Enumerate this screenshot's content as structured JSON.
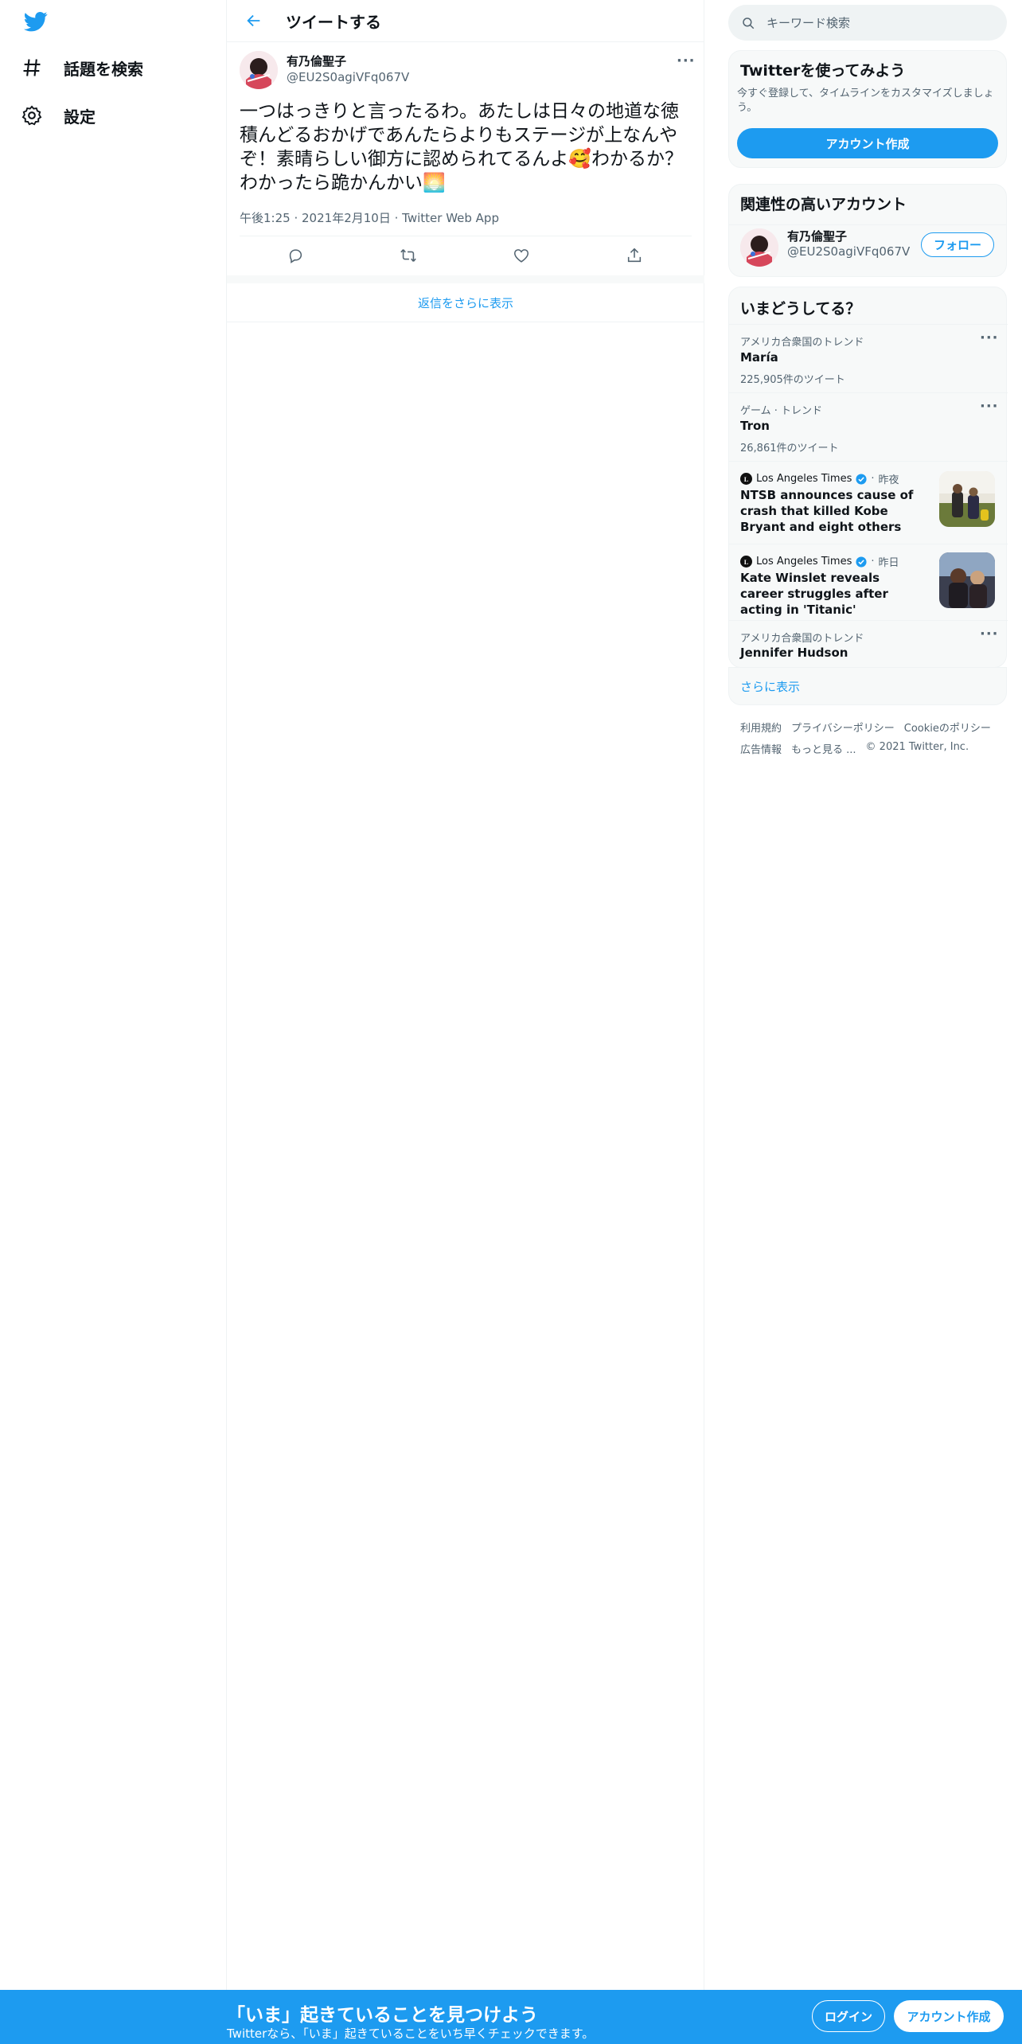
{
  "nav": {
    "items": [
      {
        "label": "話題を検索"
      },
      {
        "label": "設定"
      }
    ]
  },
  "header": {
    "title": "ツイートする"
  },
  "tweet": {
    "author_name": "有乃倫聖子",
    "author_handle": "@EU2S0agiVFq067V",
    "more": "···",
    "text": "一つはっきりと言ったるわ。あたしは日々の地道な徳積んどるおかげであんたらよりもステージが上なんやぞ！素晴らしい御方に認められてるんよ🥰わかるか？わかったら跪かんかい🌅",
    "time": "午後1:25",
    "date": "2021年2月10日",
    "source": "Twitter Web App",
    "show_replies": "返信をさらに表示"
  },
  "search": {
    "placeholder": "キーワード検索"
  },
  "signup_card": {
    "title": "Twitterを使ってみよう",
    "subtitle": "今すぐ登録して、タイムラインをカスタマイズしましょう。",
    "button": "アカウント作成"
  },
  "related": {
    "title": "関連性の高いアカウント",
    "name": "有乃倫聖子",
    "handle": "@EU2S0agiVFq067V",
    "follow": "フォロー"
  },
  "trends": {
    "title": "いまどうしてる？",
    "items": [
      {
        "context": "アメリカ合衆国のトレンド",
        "name": "María",
        "count": "225,905件のツイート"
      },
      {
        "context": "ゲーム · トレンド",
        "name": "Tron",
        "count": "26,861件のツイート"
      }
    ],
    "news": [
      {
        "source": "Los Angeles Times",
        "time": "昨夜",
        "title": "NTSB announces cause of crash that killed Kobe Bryant and eight others"
      },
      {
        "source": "Los Angeles Times",
        "time": "昨日",
        "title": "Kate Winslet reveals career struggles after acting in 'Titanic'"
      }
    ],
    "last": {
      "context": "アメリカ合衆国のトレンド",
      "name": "Jennifer Hudson"
    },
    "show_more": "さらに表示"
  },
  "footer": {
    "terms": "利用規約",
    "privacy": "プライバシーポリシー",
    "cookie": "Cookieのポリシー",
    "ads": "広告情報",
    "more": "もっと見る ...",
    "copyright": "© 2021 Twitter, Inc."
  },
  "bottom": {
    "title": "「いま」起きていることを見つけよう",
    "subtitle": "Twitterなら、「いま」起きていることをいち早くチェックできます。",
    "login": "ログイン",
    "signup": "アカウント作成"
  },
  "colors": {
    "accent": "#1d9bf0",
    "text": "#0f1419",
    "muted": "#536471",
    "border": "#eff3f4"
  }
}
